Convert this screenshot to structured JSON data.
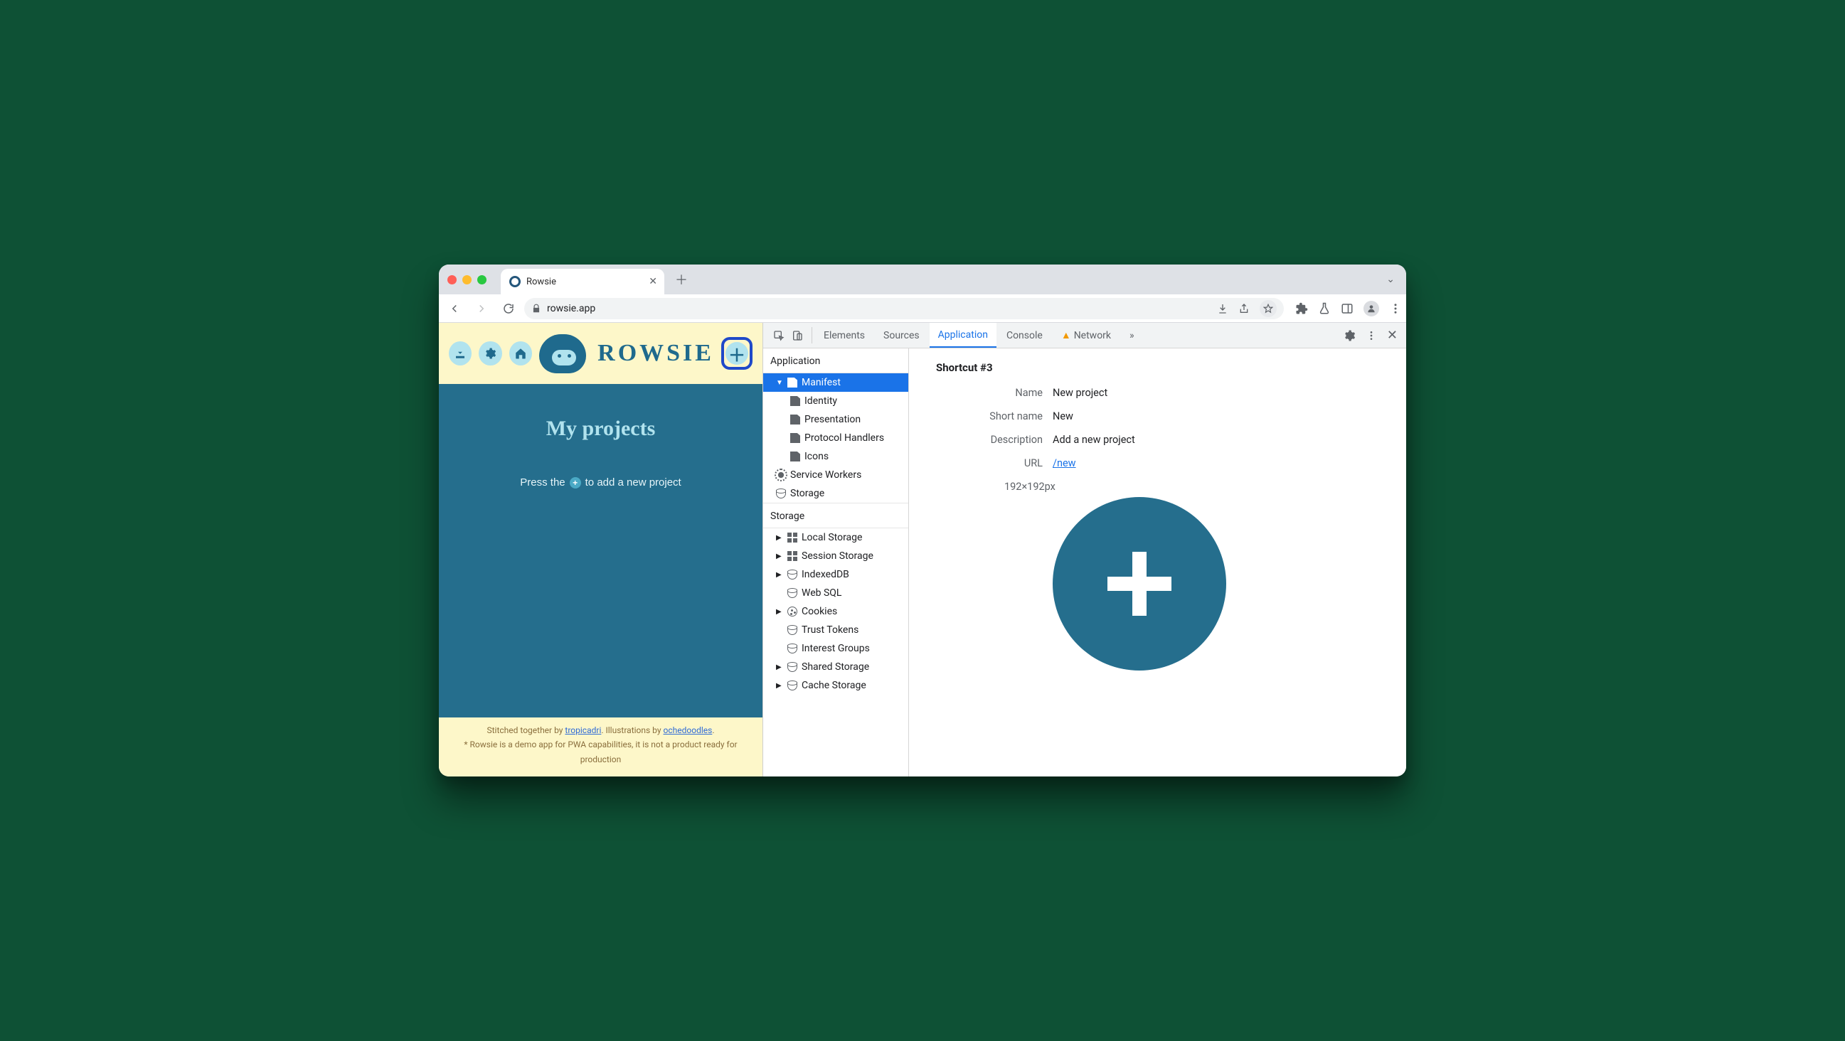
{
  "browser": {
    "tab": {
      "title": "Rowsie"
    },
    "url": "rowsie.app"
  },
  "app": {
    "brand": "ROWSIE",
    "heading": "My projects",
    "hint_pre": "Press the",
    "hint_post": "to add a new project",
    "footer_text_1": "Stitched together by ",
    "footer_link_1": "tropicadri",
    "footer_text_2": ". Illustrations by ",
    "footer_link_2": "ochedoodles",
    "footer_text_3": ".",
    "footer_disclaimer": "* Rowsie is a demo app for PWA capabilities, it is not a product ready for production"
  },
  "devtools": {
    "tabs": {
      "elements": "Elements",
      "sources": "Sources",
      "application": "Application",
      "console": "Console",
      "network": "Network"
    },
    "side": {
      "application_h": "Application",
      "items_app": {
        "manifest": "Manifest",
        "identity": "Identity",
        "presentation": "Presentation",
        "protocol": "Protocol Handlers",
        "icons": "Icons",
        "sw": "Service Workers",
        "storage": "Storage"
      },
      "storage_h": "Storage",
      "items_storage": {
        "local": "Local Storage",
        "session": "Session Storage",
        "idb": "IndexedDB",
        "websql": "Web SQL",
        "cookies": "Cookies",
        "trust": "Trust Tokens",
        "interest": "Interest Groups",
        "shared": "Shared Storage",
        "cache": "Cache Storage"
      }
    },
    "detail": {
      "title": "Shortcut #3",
      "labels": {
        "name": "Name",
        "short": "Short name",
        "desc": "Description",
        "url": "URL"
      },
      "values": {
        "name": "New project",
        "short": "New",
        "desc": "Add a new project",
        "url": "/new"
      },
      "icon_dim": "192×192px"
    }
  }
}
